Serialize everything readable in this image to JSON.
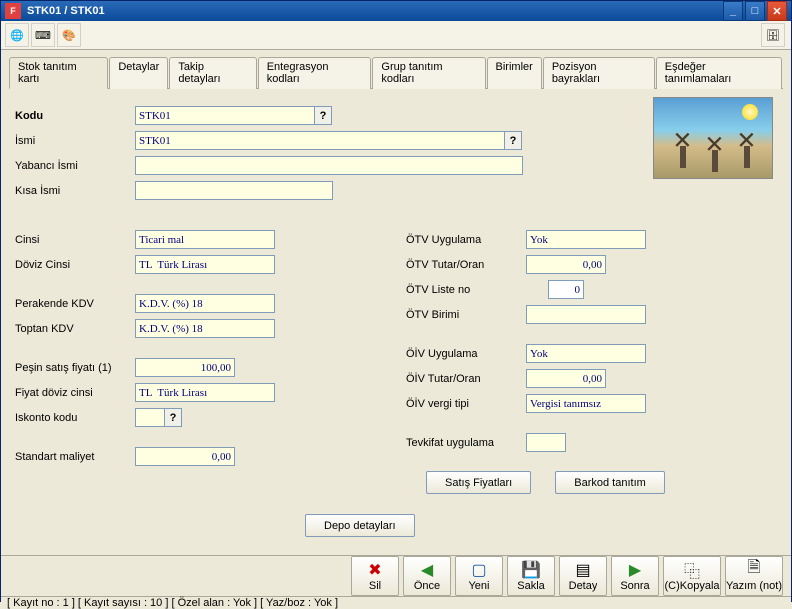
{
  "window": {
    "title": "STK01 / STK01"
  },
  "tabs": [
    "Stok tanıtım kartı",
    "Detaylar",
    "Takip detayları",
    "Entegrasyon kodları",
    "Grup tanıtım kodları",
    "Birimler",
    "Pozisyon bayrakları",
    "Eşdeğer tanımlamaları"
  ],
  "form": {
    "kodu_label": "Kodu",
    "kodu_value": "STK01",
    "ismi_label": "İsmi",
    "ismi_value": "STK01",
    "yabanci_ismi_label": "Yabancı İsmi",
    "yabanci_ismi_value": "",
    "kisa_ismi_label": "Kısa İsmi",
    "kisa_ismi_value": "",
    "cinsi_label": "Cinsi",
    "cinsi_value": "Ticari mal",
    "doviz_cinsi_label": "Döviz Cinsi",
    "doviz_cinsi_value": "TL  Türk Lirası",
    "perakende_kdv_label": "Perakende KDV",
    "perakende_kdv_value": "K.D.V. (%) 18",
    "toptan_kdv_label": "Toptan KDV",
    "toptan_kdv_value": "K.D.V. (%) 18",
    "pesin_satis_label": "Peşin satış fiyatı (1)",
    "pesin_satis_value": "100,00",
    "fiyat_doviz_label": "Fiyat döviz cinsi",
    "fiyat_doviz_value": "TL  Türk Lirası",
    "iskonto_label": "Iskonto kodu",
    "iskonto_value": "",
    "standart_maliyet_label": "Standart maliyet",
    "standart_maliyet_value": "0,00",
    "otv_uygulama_label": "ÖTV Uygulama",
    "otv_uygulama_value": "Yok",
    "otv_tutar_label": "ÖTV Tutar/Oran",
    "otv_tutar_value": "0,00",
    "otv_liste_label": "ÖTV Liste no",
    "otv_liste_value": "0",
    "otv_birimi_label": "ÖTV Birimi",
    "otv_birimi_value": "",
    "oiv_uygulama_label": "ÖİV Uygulama",
    "oiv_uygulama_value": "Yok",
    "oiv_tutar_label": "ÖİV Tutar/Oran",
    "oiv_tutar_value": "0,00",
    "oiv_vergi_label": "ÖİV vergi tipi",
    "oiv_vergi_value": "Vergisi tanımsız",
    "tevkifat_label": "Tevkifat uygulama",
    "tevkifat_value": ""
  },
  "buttons": {
    "satis_fiyatlari": "Satış Fiyatları",
    "barkod_tanitim": "Barkod tanıtım",
    "depo_detaylari": "Depo detayları"
  },
  "bottom": [
    {
      "label": "Sil",
      "icon": "✖",
      "color": "#c00"
    },
    {
      "label": "Önce",
      "icon": "◀",
      "color": "#2a8a2a"
    },
    {
      "label": "Yeni",
      "icon": "▢",
      "color": "#1a5aa8"
    },
    {
      "label": "Sakla",
      "icon": "💾",
      "color": "#1a5aa8"
    },
    {
      "label": "Detay",
      "icon": "▤",
      "color": "#888"
    },
    {
      "label": "Sonra",
      "icon": "▶",
      "color": "#2a8a2a"
    },
    {
      "label": "(C)Kopyala",
      "icon": "⿻",
      "color": "#888"
    },
    {
      "label": "Yazım (not)",
      "icon": "🗎",
      "color": "#888"
    }
  ],
  "status": "[ Kayıt no : 1 ] [ Kayıt sayısı : 10 ] [ Özel alan : Yok ] [ Yaz/boz : Yok ]"
}
